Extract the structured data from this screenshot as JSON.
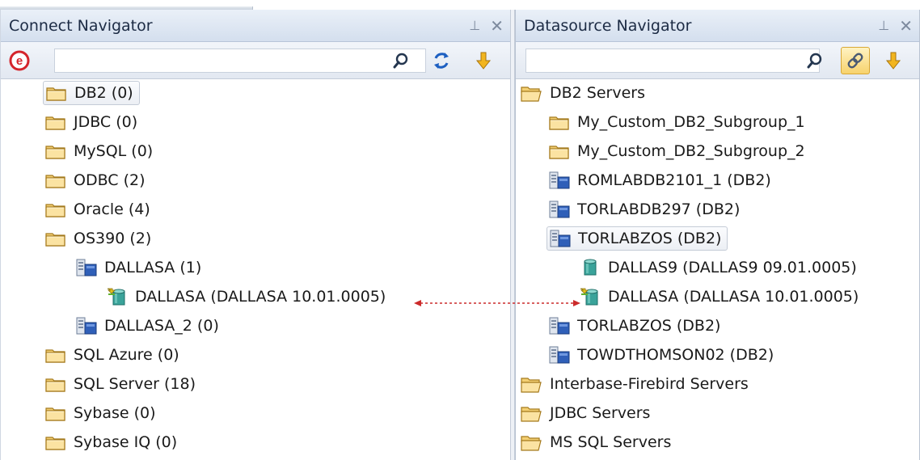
{
  "left_panel": {
    "title": "Connect Navigator",
    "pin_glyph": "⊥",
    "close_glyph": "✕",
    "search": {
      "value": "",
      "placeholder": ""
    },
    "toolbar_icons": [
      "logo-e-icon",
      "search-icon",
      "refresh-icon",
      "arrow-down-icon"
    ],
    "tree": [
      {
        "label": "DB2 (0)",
        "icon": "folder-icon"
      },
      {
        "label": "JDBC (0)",
        "icon": "folder-icon"
      },
      {
        "label": "MySQL (0)",
        "icon": "folder-icon"
      },
      {
        "label": "ODBC (2)",
        "icon": "folder-icon"
      },
      {
        "label": "Oracle (4)",
        "icon": "folder-icon"
      },
      {
        "label": "OS390 (2)",
        "icon": "folder-icon"
      },
      {
        "label": "DALLASA (1)",
        "icon": "server-icon"
      },
      {
        "label": "DALLASA (DALLASA 10.01.0005)",
        "icon": "connected-database-icon"
      },
      {
        "label": "DALLASA_2 (0)",
        "icon": "server-icon"
      },
      {
        "label": "SQL Azure (0)",
        "icon": "folder-icon"
      },
      {
        "label": "SQL Server (18)",
        "icon": "folder-icon"
      },
      {
        "label": "Sybase (0)",
        "icon": "folder-icon"
      },
      {
        "label": "Sybase IQ (0)",
        "icon": "folder-icon"
      }
    ]
  },
  "right_panel": {
    "title": "Datasource Navigator",
    "pin_glyph": "⊥",
    "close_glyph": "✕",
    "search": {
      "value": "",
      "placeholder": ""
    },
    "toolbar_icons": [
      "search-icon",
      "link-icon",
      "arrow-down-icon"
    ],
    "tree": [
      {
        "label": "DB2 Servers",
        "icon": "open-folder-icon"
      },
      {
        "label": "My_Custom_DB2_Subgroup_1",
        "icon": "folder-icon"
      },
      {
        "label": "My_Custom_DB2_Subgroup_2",
        "icon": "folder-icon"
      },
      {
        "label": "ROMLABDB2101_1 (DB2)",
        "icon": "server-icon"
      },
      {
        "label": "TORLABDB297 (DB2)",
        "icon": "server-icon"
      },
      {
        "label": "TORLABZOS (DB2)",
        "icon": "server-icon"
      },
      {
        "label": "DALLAS9 (DALLAS9 09.01.0005)",
        "icon": "database-icon"
      },
      {
        "label": "DALLASA (DALLASA 10.01.0005)",
        "icon": "connected-database-icon"
      },
      {
        "label": "TORLABZOS (DB2)",
        "icon": "server-icon"
      },
      {
        "label": "TOWDTHOMSON02 (DB2)",
        "icon": "server-icon"
      },
      {
        "label": "Interbase-Firebird Servers",
        "icon": "open-folder-icon"
      },
      {
        "label": "JDBC Servers",
        "icon": "open-folder-icon"
      },
      {
        "label": "MS SQL Servers",
        "icon": "open-folder-icon"
      }
    ]
  },
  "colors": {
    "title_gradient_top": "#eaf0f8",
    "title_gradient_bottom": "#d4dfee",
    "folder_fill": "#f6d98a",
    "link_arrow": "#cc2b2b"
  }
}
